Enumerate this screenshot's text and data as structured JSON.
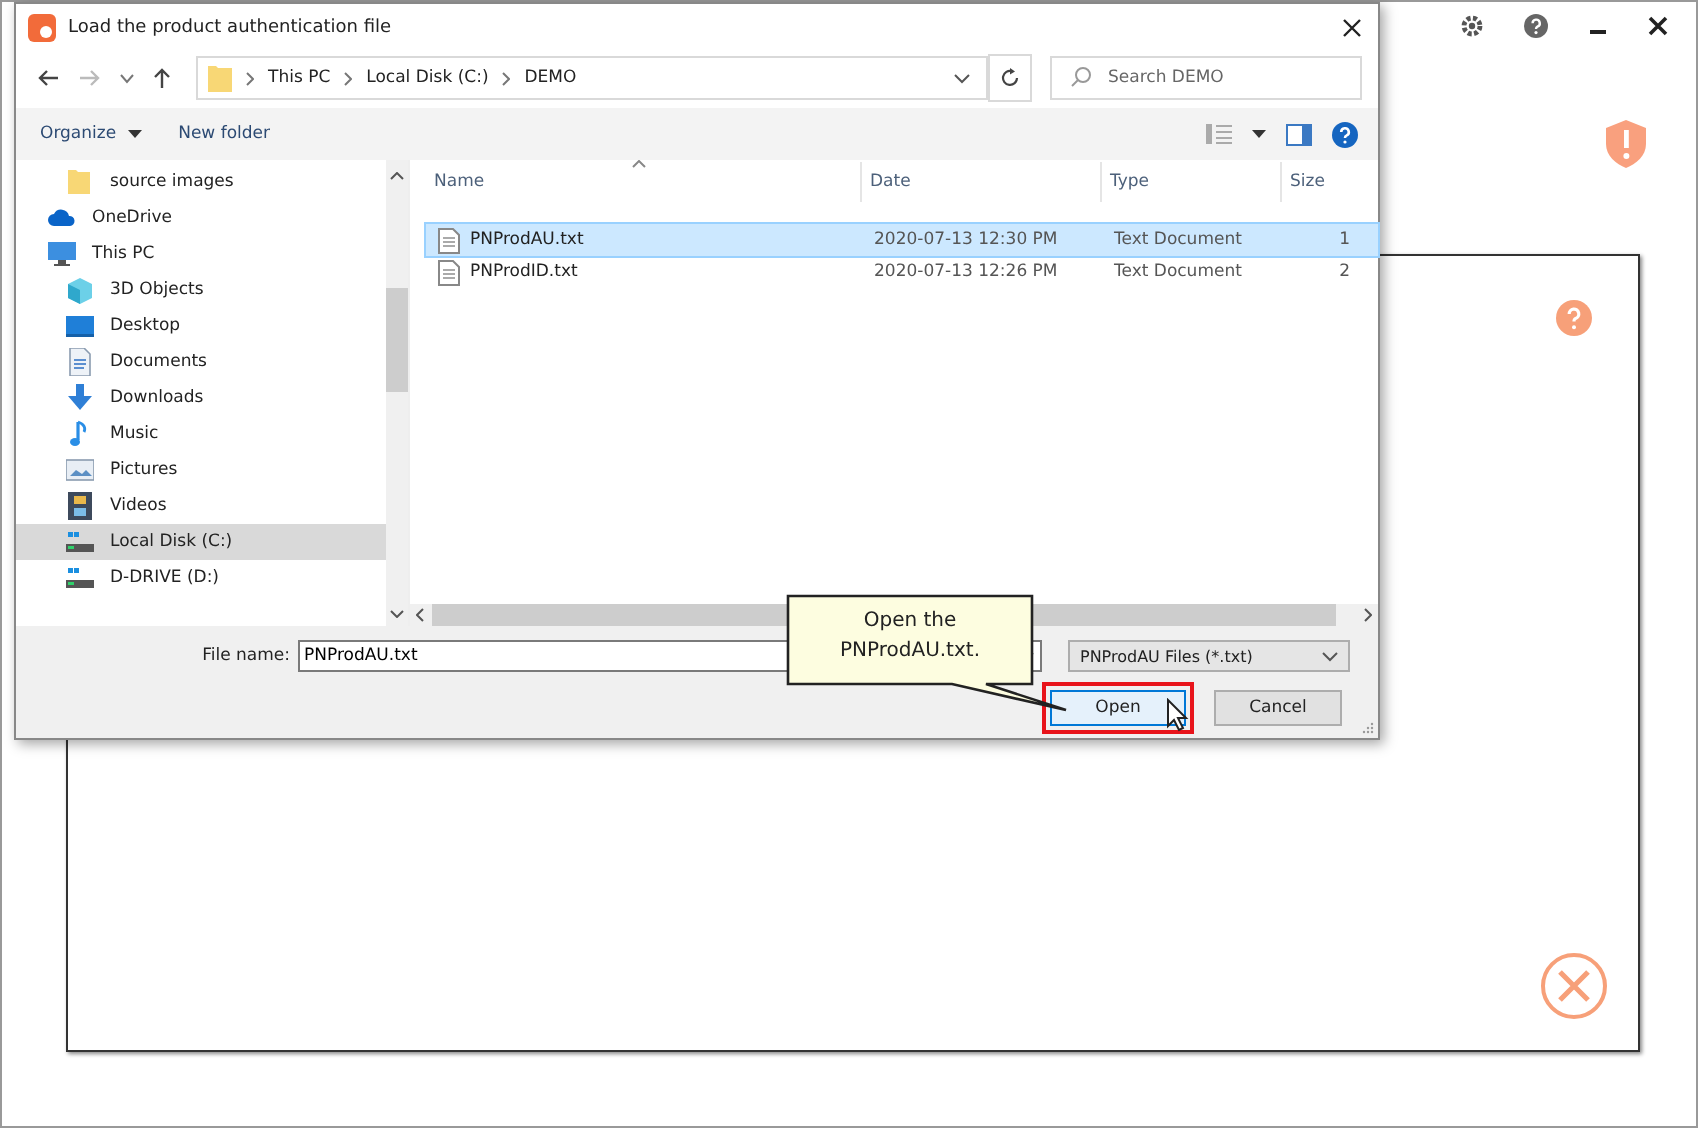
{
  "dialog": {
    "title": "Load the product authentication file",
    "address": {
      "crumbs": [
        "This PC",
        "Local Disk (C:)",
        "DEMO"
      ]
    },
    "search": {
      "placeholder": "Search DEMO"
    },
    "toolbar": {
      "organize": "Organize",
      "new_folder": "New folder"
    },
    "sidebar": {
      "items": [
        {
          "label": "source images",
          "indent": true,
          "selected": false
        },
        {
          "label": "OneDrive",
          "indent": false,
          "selected": false
        },
        {
          "label": "This PC",
          "indent": false,
          "selected": false
        },
        {
          "label": "3D Objects",
          "indent": true,
          "selected": false
        },
        {
          "label": "Desktop",
          "indent": true,
          "selected": false
        },
        {
          "label": "Documents",
          "indent": true,
          "selected": false
        },
        {
          "label": "Downloads",
          "indent": true,
          "selected": false
        },
        {
          "label": "Music",
          "indent": true,
          "selected": false
        },
        {
          "label": "Pictures",
          "indent": true,
          "selected": false
        },
        {
          "label": "Videos",
          "indent": true,
          "selected": false
        },
        {
          "label": "Local Disk (C:)",
          "indent": true,
          "selected": true
        },
        {
          "label": "D-DRIVE (D:)",
          "indent": true,
          "selected": false
        }
      ]
    },
    "table": {
      "columns": [
        "Name",
        "Date",
        "Type",
        "Size"
      ],
      "rows": [
        {
          "cells": [
            "PNProdAU.txt",
            "2020-07-13 12:30 PM",
            "Text Document",
            "1"
          ],
          "selected": true
        },
        {
          "cells": [
            "PNProdID.txt",
            "2020-07-13 12:26 PM",
            "Text Document",
            "2"
          ],
          "selected": false
        }
      ]
    },
    "file_name": {
      "label": "File name:",
      "value": "PNProdAU.txt"
    },
    "filter": {
      "value": "PNProdAU Files (*.txt)"
    },
    "buttons": [
      {
        "label": "Open",
        "kind": "primary",
        "highlighted": true
      },
      {
        "label": "Cancel",
        "kind": "normal",
        "highlighted": false
      }
    ]
  },
  "callout": {
    "text": "Open the PNProdAU.txt."
  }
}
